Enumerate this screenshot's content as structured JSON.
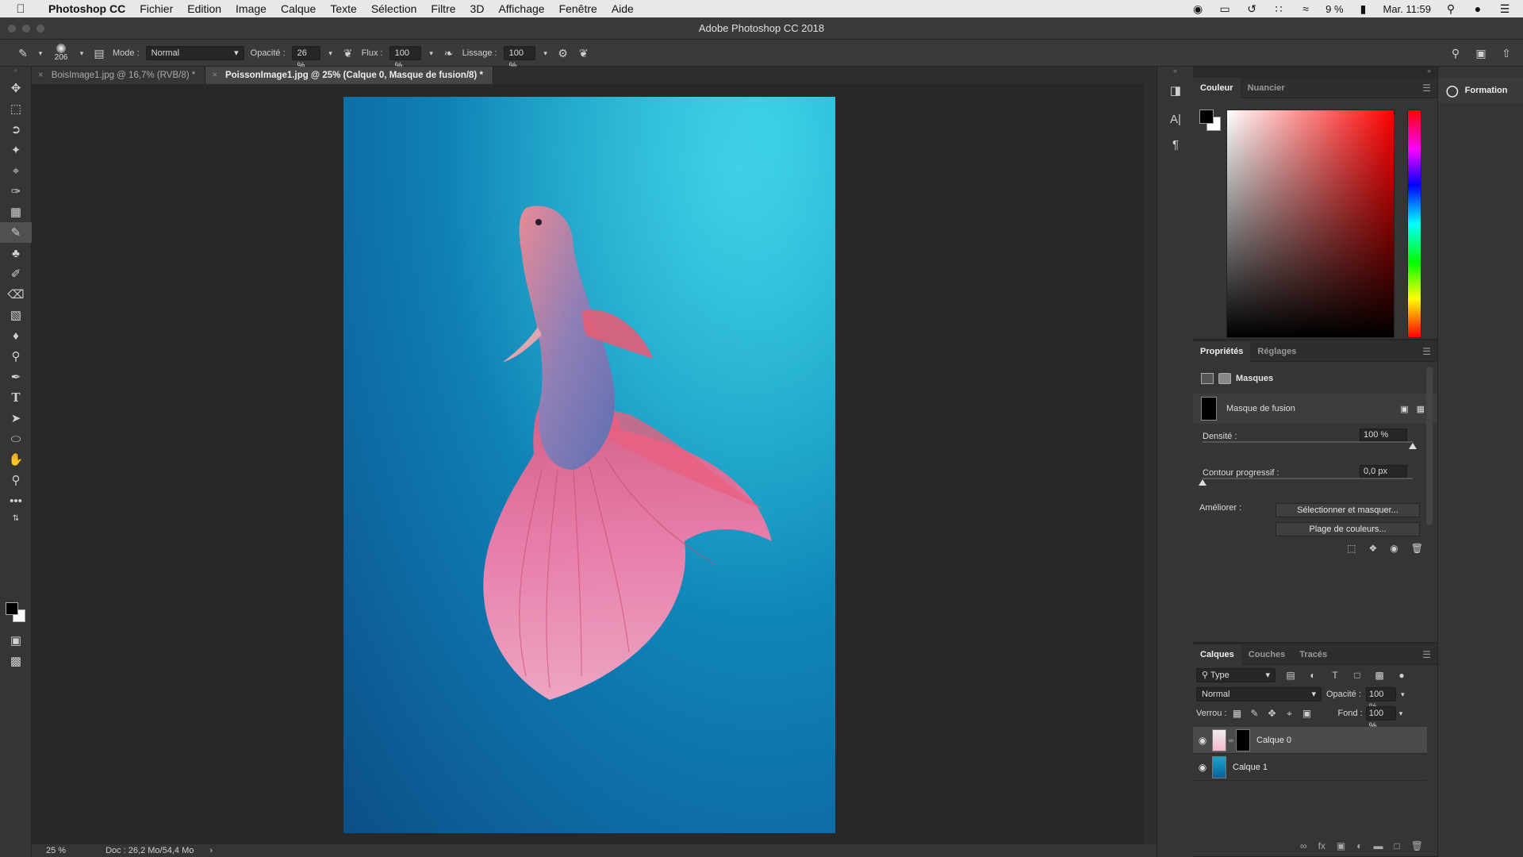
{
  "menubar": {
    "app_name": "Photoshop CC",
    "items": [
      "Fichier",
      "Edition",
      "Image",
      "Calque",
      "Texte",
      "Sélection",
      "Filtre",
      "3D",
      "Affichage",
      "Fenêtre",
      "Aide"
    ],
    "battery": "9 %",
    "clock": "Mar. 11:59"
  },
  "window": {
    "title": "Adobe Photoshop CC 2018"
  },
  "options": {
    "brush_size": "206",
    "mode_label": "Mode :",
    "mode_value": "Normal",
    "opacity_label": "Opacité :",
    "opacity_value": "26 %",
    "flow_label": "Flux :",
    "flow_value": "100 %",
    "smoothing_label": "Lissage :",
    "smoothing_value": "100 %"
  },
  "tabs": [
    {
      "label": "BoisImage1.jpg @ 16,7% (RVB/8) *"
    },
    {
      "label": "PoissonImage1.jpg @ 25% (Calque 0, Masque de fusion/8) *"
    }
  ],
  "status": {
    "zoom": "25 %",
    "doc": "Doc : 26,2 Mo/54,4 Mo",
    "arrow": "›"
  },
  "color_panel": {
    "tabs": [
      "Couleur",
      "Nuancier"
    ],
    "foreground": "#000000",
    "background": "#ffffff"
  },
  "properties": {
    "tabs": [
      "Propriétés",
      "Réglages"
    ],
    "section": "Masques",
    "mask_name": "Masque de fusion",
    "density_label": "Densité :",
    "density_value": "100 %",
    "density": 1.0,
    "feather_label": "Contour progressif :",
    "feather_value": "0,0 px",
    "feather": 0.0,
    "refine_label": "Améliorer :",
    "btn_select_mask": "Sélectionner et masquer...",
    "btn_color_range": "Plage de couleurs..."
  },
  "layers": {
    "tabs": [
      "Calques",
      "Couches",
      "Tracés"
    ],
    "filter": "Type",
    "blend": "Normal",
    "opacity_label": "Opacité :",
    "opacity_value": "100 %",
    "lock_label": "Verrou :",
    "fill_label": "Fond :",
    "fill_value": "100 %",
    "items": [
      {
        "name": "Calque 0",
        "selected": true
      },
      {
        "name": "Calque 1",
        "selected": false
      }
    ]
  },
  "learn": {
    "title": "Formation"
  }
}
